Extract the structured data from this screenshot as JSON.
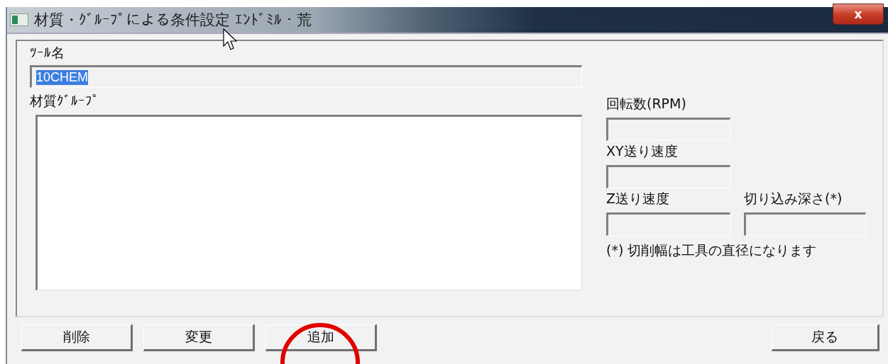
{
  "window": {
    "title": "材質・ｸﾞﾙｰﾌﾟによる条件設定 ｴﾝﾄﾞﾐﾙ・荒",
    "close": "x"
  },
  "tool_name": {
    "label": "ﾂｰﾙ名",
    "value": "10CHEM",
    "text_selected": true
  },
  "material_group": {
    "label": "材質ｸﾞﾙｰﾌﾟ"
  },
  "fields": [
    {
      "label": "回転数(RPM)"
    },
    {
      "label": "XY送り速度"
    },
    {
      "label": "Z送り速度"
    },
    {
      "label": "切り込み深さ(*)"
    }
  ],
  "note": "(*) 切削幅は工具の直径になります",
  "buttons": [
    {
      "label": "削除",
      "highlighted": false
    },
    {
      "label": "変更",
      "highlighted": false
    },
    {
      "label": "追加",
      "highlighted": true
    },
    {
      "label": "戻る",
      "highlighted": false
    }
  ]
}
